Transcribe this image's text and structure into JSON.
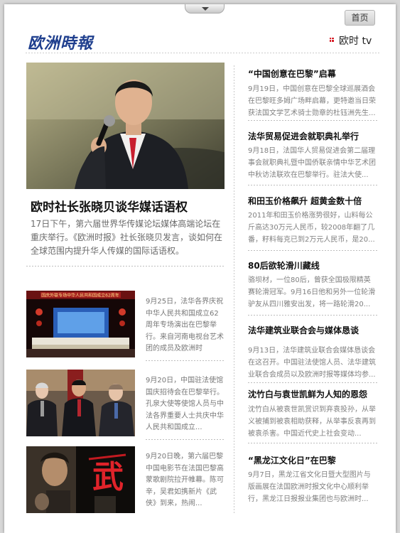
{
  "header": {
    "home_label": "首页",
    "logo_text": "欧洲時報",
    "tv_label": "欧时 tv",
    "accent_color": "#d6202a",
    "logo_color": "#1f3f8e"
  },
  "featured": {
    "title": "欧时社长张晓贝谈华媒话语权",
    "summary": "17日下午，第六届世界华传媒论坛媒体高端论坛在重庆举行。《欧洲时报》社长张晓贝发言，谈如何在全球范围内提升华人传媒的国际话语权。"
  },
  "thumb_items": [
    {
      "text": "9月25日，法华各界庆祝中华人民共和国成立62周年专场演出在巴黎举行。来自河南电视台艺术团的成员及欧洲时"
    },
    {
      "text": "9月20日，中国驻法使馆国庆招待会在巴黎举行。孔泉大使等使馆人员与中法各界重要人士共庆中华人民共和国成立..."
    },
    {
      "text": "9月20日晚，第六届巴黎中国电影节在法国巴黎高蒙歌剧院拉开帷幕。陈可辛，吴君如携新片《武侠》到来，热闹..."
    }
  ],
  "right_items": [
    {
      "title": "“中国创意在巴黎”启幕",
      "summary": "9月19日，中国创意在巴黎全球巡展酒会在巴黎旺多姆广场畔启幕，更特邀当日荣获法国文学艺术骑士勋章的杜钰洲先生..."
    },
    {
      "title": "法华贸易促进会就职典礼举行",
      "summary": "9月18日，法国华人贸易促进会第二届理事会就职典礼暨中国侨联亲情中华艺术团中秋访法联欢在巴黎举行。驻法大使..."
    },
    {
      "title": "和田玉价格飙升 超黄金数十倍",
      "summary": "2011年和田玉价格涨势很好，山料每公斤高达30万元人民币，较2008年翻了几番，籽料每克已到2万元人民币，是20..."
    },
    {
      "title": "80后欲轮滑川藏线",
      "summary": "骆坝材，一位80后，曾获全国极限精英赛轮滑冠军。9月16日他和另外一位轮滑驴友从四川雅安出发，将一路轮滑20..."
    },
    {
      "title": "法华建筑业联合会与媒体恳谈",
      "summary": "9月13日，法华建筑业联合会媒体恳谈会在这召开。中国驻法使馆人员、法华建筑业联合会成员以及欧洲时报等媒体均参..."
    },
    {
      "title": "沈竹白与袁世凯鲜为人知的恩怨",
      "summary": "沈竹白从被袁世凯赏识到弃袁投孙，从举义被捕到被袁相助获释，从举事反袁再到被袁杀害。中国近代史上社会变动..."
    },
    {
      "title": "“黑龙江文化日”在巴黎",
      "summary": "9月7日，黑龙江省文化日暨大型图片与版画展在法国欧洲时报文化中心顺利举行，黑龙江日报报业集团也与欧洲时..."
    }
  ],
  "thumb_overlay": {
    "banner_text": "国庆外联专场中华人民共和国成立62周年",
    "calligraphy": "武"
  }
}
